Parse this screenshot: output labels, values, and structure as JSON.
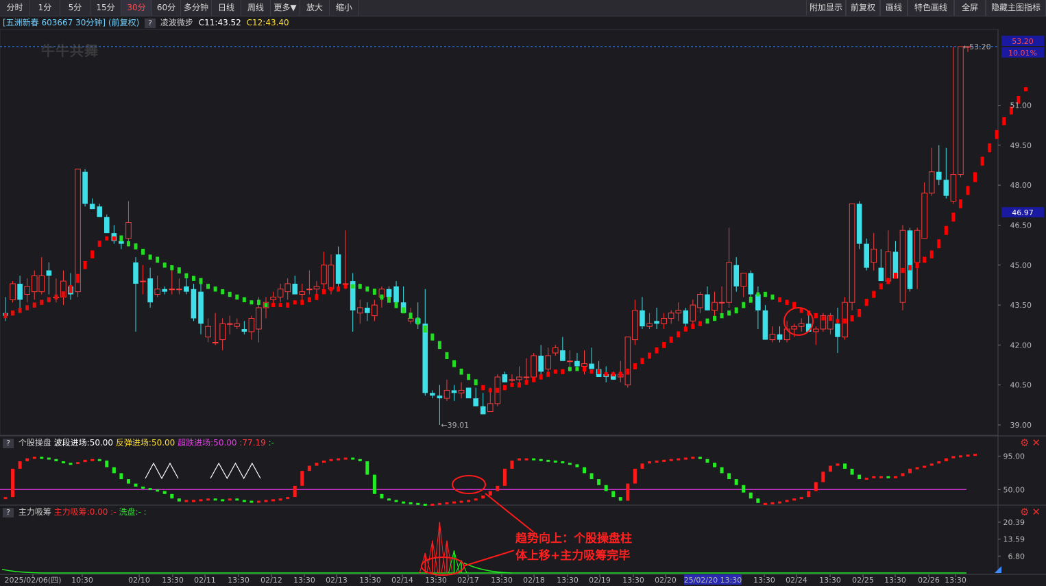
{
  "toolbar": {
    "left": [
      "分时",
      "1分",
      "5分",
      "15分",
      "30分",
      "60分",
      "多分钟",
      "日线",
      "周线",
      "更多▼",
      "放大",
      "缩小"
    ],
    "active_index": 4,
    "right": [
      "附加显示",
      "前复权",
      "画线",
      "特色画线",
      "全屏",
      "隐藏主图指标"
    ]
  },
  "info": {
    "stock": "[五洲新春 603667 30分钟] (前复权)",
    "indicator": "凌波微步",
    "c1": "C11:43.52",
    "c2": "C12:43.40"
  },
  "watermark": "牛牛共舞",
  "colors": {
    "up": "#ff3b3b",
    "down": "#3de0e8",
    "ma_up": "#ff0000",
    "ma_down": "#22dd22",
    "purple": "#cc33cc",
    "axis_text": "#b8b8b8",
    "grid": "#2e2e36",
    "price_box": "#1a1aa0"
  },
  "chart_data": [
    {
      "name": "main",
      "type": "candlestick",
      "y_ticks": [
        39.0,
        40.5,
        42.0,
        43.5,
        45.0,
        46.5,
        48.0,
        49.5,
        51.0
      ],
      "ylim": [
        39.0,
        53.2
      ],
      "tags": {
        "high_price": "53.20",
        "high_pct": "10.01%",
        "current": "46.97"
      },
      "labels": {
        "max": "53.20",
        "min": "39.01"
      },
      "x_labels": [
        "2025/02/06(四)",
        "10:30",
        "02/10",
        "13:30",
        "02/11",
        "13:30",
        "02/12",
        "13:30",
        "02/13",
        "13:30",
        "02/14",
        "13:30",
        "02/17",
        "13:30",
        "02/18",
        "13:30",
        "02/19",
        "13:30",
        "02/20",
        "25/02/20 13:30",
        "13:30",
        "02/24",
        "13:30",
        "02/25",
        "13:30",
        "02/26",
        "13:30"
      ],
      "candles": [
        [
          43.2,
          43.8,
          42.9,
          43.1
        ],
        [
          43.7,
          44.4,
          43.6,
          44.3
        ],
        [
          44.3,
          44.6,
          43.4,
          43.7
        ],
        [
          43.9,
          44.5,
          43.6,
          44.2
        ],
        [
          44.0,
          44.8,
          43.7,
          44.6
        ],
        [
          44.0,
          45.3,
          43.9,
          44.6
        ],
        [
          44.8,
          45.1,
          43.9,
          44.6
        ],
        [
          43.8,
          44.5,
          43.6,
          43.8
        ],
        [
          43.8,
          44.8,
          43.5,
          44.4
        ],
        [
          44.2,
          44.7,
          43.7,
          43.9
        ],
        [
          44.0,
          48.6,
          43.8,
          48.6
        ],
        [
          48.5,
          48.6,
          47.2,
          47.3
        ],
        [
          47.3,
          47.5,
          47.1,
          47.1
        ],
        [
          47.2,
          47.3,
          46.8,
          46.8
        ],
        [
          46.8,
          46.9,
          46.2,
          46.2
        ],
        [
          46.2,
          46.5,
          45.8,
          45.9
        ],
        [
          45.9,
          46.1,
          45.6,
          45.8
        ],
        [
          46.0,
          47.4,
          45.7,
          46.6
        ],
        [
          45.1,
          45.3,
          42.5,
          44.3
        ],
        [
          44.4,
          45.0,
          43.9,
          44.4
        ],
        [
          44.5,
          44.9,
          43.4,
          43.6
        ],
        [
          43.9,
          44.6,
          43.8,
          44.1
        ],
        [
          44.1,
          44.2,
          43.9,
          44.0
        ],
        [
          44.1,
          44.8,
          43.9,
          44.1
        ],
        [
          44.1,
          44.5,
          43.9,
          44.1
        ],
        [
          44.2,
          44.6,
          43.9,
          44.0
        ],
        [
          44.1,
          44.3,
          42.9,
          43.0
        ],
        [
          44.0,
          44.3,
          42.4,
          42.8
        ],
        [
          42.3,
          43.0,
          42.1,
          42.7
        ],
        [
          42.1,
          43.2,
          42.0,
          42.1
        ],
        [
          42.2,
          43.0,
          41.8,
          42.8
        ],
        [
          42.8,
          43.1,
          42.4,
          42.8
        ],
        [
          42.7,
          43.0,
          42.6,
          42.8
        ],
        [
          42.6,
          42.9,
          42.4,
          42.5
        ],
        [
          42.5,
          43.1,
          42.2,
          43.0
        ],
        [
          42.6,
          43.8,
          42.1,
          43.4
        ],
        [
          43.4,
          43.8,
          43.0,
          43.6
        ],
        [
          43.7,
          44.0,
          43.5,
          43.8
        ],
        [
          43.8,
          44.3,
          43.6,
          44.1
        ],
        [
          44.0,
          44.5,
          43.7,
          44.3
        ],
        [
          44.3,
          44.6,
          43.9,
          43.9
        ],
        [
          43.9,
          44.3,
          43.6,
          44.0
        ],
        [
          44.1,
          44.8,
          43.9,
          44.1
        ],
        [
          44.1,
          44.4,
          43.7,
          44.2
        ],
        [
          44.3,
          45.5,
          44.1,
          45.0
        ],
        [
          44.1,
          45.4,
          43.9,
          45.0
        ],
        [
          45.4,
          45.7,
          44.0,
          44.3
        ],
        [
          44.3,
          46.3,
          44.1,
          44.3
        ],
        [
          44.4,
          44.7,
          42.5,
          43.3
        ],
        [
          43.2,
          43.7,
          42.8,
          43.4
        ],
        [
          43.4,
          43.6,
          42.9,
          43.2
        ],
        [
          43.1,
          43.7,
          42.9,
          43.5
        ],
        [
          43.8,
          44.2,
          43.4,
          44.1
        ],
        [
          44.1,
          44.2,
          43.6,
          43.8
        ],
        [
          44.2,
          44.4,
          43.5,
          43.6
        ],
        [
          43.6,
          44.2,
          43.2,
          43.2
        ],
        [
          42.9,
          43.4,
          42.8,
          43.0
        ],
        [
          43.0,
          43.6,
          42.6,
          42.8
        ],
        [
          42.8,
          44.1,
          40.1,
          40.2
        ],
        [
          40.2,
          40.3,
          40.0,
          40.1
        ],
        [
          40.1,
          40.5,
          39.0,
          40.0
        ],
        [
          40.0,
          40.7,
          39.9,
          40.3
        ],
        [
          40.3,
          40.5,
          39.9,
          40.2
        ],
        [
          40.2,
          40.6,
          40.0,
          40.3
        ],
        [
          40.4,
          40.4,
          40.0,
          40.0
        ],
        [
          40.0,
          40.4,
          39.7,
          39.7
        ],
        [
          39.7,
          40.2,
          39.5,
          39.4
        ],
        [
          39.5,
          40.4,
          39.5,
          39.8
        ],
        [
          39.8,
          40.9,
          39.7,
          40.8
        ],
        [
          40.9,
          41.0,
          40.6,
          40.6
        ],
        [
          40.7,
          40.9,
          40.6,
          40.7
        ],
        [
          40.7,
          41.2,
          40.6,
          40.8
        ],
        [
          40.8,
          41.5,
          40.7,
          40.8
        ],
        [
          40.8,
          41.7,
          40.7,
          41.6
        ],
        [
          41.6,
          42.0,
          40.8,
          41.0
        ],
        [
          41.1,
          41.9,
          41.0,
          41.6
        ],
        [
          41.7,
          42.0,
          41.6,
          41.9
        ],
        [
          41.8,
          42.3,
          41.4,
          41.4
        ],
        [
          41.4,
          41.8,
          41.0,
          41.4
        ],
        [
          41.4,
          41.7,
          41.1,
          41.2
        ],
        [
          41.2,
          41.8,
          40.9,
          41.3
        ],
        [
          41.3,
          41.9,
          41.2,
          41.1
        ],
        [
          41.1,
          41.4,
          40.9,
          40.8
        ],
        [
          40.9,
          41.2,
          40.6,
          40.8
        ],
        [
          40.9,
          41.0,
          40.7,
          40.7
        ],
        [
          40.8,
          41.4,
          40.6,
          40.9
        ],
        [
          40.5,
          41.6,
          40.4,
          42.3
        ],
        [
          42.2,
          43.7,
          42.0,
          43.3
        ],
        [
          43.3,
          43.8,
          42.6,
          42.7
        ],
        [
          42.7,
          43.2,
          42.6,
          42.8
        ],
        [
          42.9,
          43.4,
          42.6,
          42.8
        ],
        [
          42.8,
          43.2,
          42.6,
          43.0
        ],
        [
          43.0,
          43.3,
          42.8,
          43.2
        ],
        [
          43.2,
          43.6,
          42.9,
          43.3
        ],
        [
          43.3,
          43.4,
          42.6,
          42.8
        ],
        [
          42.9,
          43.7,
          42.6,
          43.5
        ],
        [
          43.4,
          44.0,
          43.2,
          43.9
        ],
        [
          43.9,
          44.2,
          43.3,
          43.3
        ],
        [
          43.3,
          44.0,
          43.1,
          43.6
        ],
        [
          43.6,
          44.2,
          43.2,
          43.6
        ],
        [
          43.6,
          46.4,
          43.4,
          45.1
        ],
        [
          45.0,
          45.3,
          44.0,
          44.2
        ],
        [
          44.2,
          44.6,
          43.8,
          44.7
        ],
        [
          44.7,
          44.8,
          43.7,
          43.9
        ],
        [
          43.9,
          44.2,
          42.6,
          43.3
        ],
        [
          43.3,
          43.5,
          42.2,
          42.2
        ],
        [
          42.2,
          42.7,
          42.1,
          42.4
        ],
        [
          42.4,
          42.7,
          42.1,
          42.2
        ],
        [
          42.2,
          42.9,
          42.1,
          42.6
        ],
        [
          42.6,
          42.8,
          42.3,
          42.7
        ],
        [
          42.7,
          43.0,
          42.5,
          42.8
        ],
        [
          42.8,
          43.2,
          42.6,
          42.5
        ],
        [
          42.5,
          42.7,
          42.0,
          42.6
        ],
        [
          42.6,
          43.2,
          42.5,
          43.1
        ],
        [
          42.6,
          43.2,
          42.4,
          43.1
        ],
        [
          42.8,
          43.4,
          41.7,
          42.3
        ],
        [
          42.3,
          43.8,
          42.2,
          43.6
        ],
        [
          43.6,
          47.3,
          43.3,
          47.3
        ],
        [
          47.3,
          47.4,
          45.6,
          45.8
        ],
        [
          45.8,
          46.0,
          44.8,
          44.9
        ],
        [
          45.1,
          46.2,
          44.8,
          45.6
        ],
        [
          44.9,
          45.6,
          44.5,
          44.4
        ],
        [
          44.4,
          46.3,
          44.3,
          45.5
        ],
        [
          45.5,
          45.9,
          44.9,
          44.5
        ],
        [
          43.6,
          46.5,
          43.3,
          46.3
        ],
        [
          46.3,
          46.4,
          44.0,
          44.1
        ],
        [
          45.1,
          46.4,
          44.1,
          46.3
        ],
        [
          46.0,
          48.1,
          46.1,
          47.7
        ],
        [
          47.7,
          49.4,
          47.6,
          48.5
        ],
        [
          48.5,
          49.5,
          48.0,
          48.2
        ],
        [
          48.2,
          49.4,
          47.5,
          47.6
        ],
        [
          47.4,
          53.2,
          47.3,
          48.4
        ],
        [
          48.4,
          53.2,
          48.3,
          53.2
        ],
        [
          53.2,
          53.2,
          53.0,
          53.2
        ]
      ],
      "ma": [
        43.1,
        43.2,
        43.3,
        43.4,
        43.5,
        43.6,
        43.7,
        43.8,
        43.9,
        44.1,
        44.5,
        45.0,
        45.4,
        45.8,
        46.0,
        46.0,
        46.0,
        45.8,
        45.7,
        45.5,
        45.3,
        45.2,
        45.0,
        44.9,
        44.8,
        44.6,
        44.5,
        44.4,
        44.2,
        44.1,
        44.0,
        43.9,
        43.8,
        43.7,
        43.6,
        43.6,
        43.5,
        43.5,
        43.5,
        43.5,
        43.6,
        43.6,
        43.7,
        43.8,
        44.0,
        44.1,
        44.1,
        44.2,
        44.2,
        44.2,
        44.1,
        44.0,
        43.8,
        43.7,
        43.5,
        43.3,
        43.1,
        42.9,
        42.6,
        42.3,
        42.0,
        41.6,
        41.3,
        41.0,
        40.8,
        40.6,
        40.4,
        40.3,
        40.3,
        40.4,
        40.5,
        40.5,
        40.6,
        40.7,
        40.8,
        40.9,
        41.0,
        41.0,
        41.1,
        41.1,
        41.1,
        41.0,
        41.0,
        40.9,
        40.9,
        40.9,
        41.0,
        41.2,
        41.4,
        41.6,
        41.8,
        42.0,
        42.2,
        42.4,
        42.6,
        42.7,
        42.8,
        42.9,
        43.0,
        43.1,
        43.2,
        43.3,
        43.5,
        43.7,
        43.9,
        43.9,
        43.8,
        43.7,
        43.6,
        43.5,
        43.3,
        43.2,
        43.1,
        43.0,
        43.0,
        42.9,
        42.9,
        43.0,
        43.2,
        43.6,
        43.9,
        44.2,
        44.4,
        44.6,
        44.8,
        44.9,
        45.0,
        45.2,
        45.4,
        45.8,
        46.3,
        46.8,
        47.3,
        47.8,
        48.3,
        48.9,
        49.4,
        49.9,
        50.4,
        50.8,
        51.2,
        51.6
      ],
      "ma_colors": "ddddddddddrrrrrrgggggggggggggggggggggrrrrrrrrrrrggggggggggggggggggrrrrrrrrrrrrggrrrrrrrrrrrrrrrrrggggggggggrrrrrrrrrrrrrrrrrrrrrrrrrrrr"
    },
    {
      "name": "个股操盘",
      "type": "bar",
      "header": {
        "title": "个股操盘",
        "f1": "波段进场:50.00",
        "f2": "反弹进场:50.00",
        "f3": "超跌进场:50.00",
        "f4": ":77.19",
        "f5": ":-"
      },
      "y_ticks": [
        95.0,
        50.0
      ],
      "ylim": [
        30,
        100
      ],
      "values": [
        40,
        78,
        88,
        92,
        94,
        93,
        91,
        88,
        86,
        85,
        87,
        90,
        91,
        89,
        80,
        72,
        64,
        58,
        54,
        52,
        50,
        48,
        44,
        38,
        34,
        36,
        36,
        37,
        38,
        37,
        36,
        38,
        36,
        35,
        34,
        35,
        36,
        37,
        38,
        40,
        55,
        75,
        82,
        86,
        89,
        91,
        92,
        93,
        91,
        88,
        70,
        44,
        38,
        36,
        34,
        33,
        32,
        31,
        30,
        31,
        32,
        33,
        34,
        35,
        36,
        38,
        42,
        48,
        55,
        78,
        89,
        92,
        92,
        91,
        90,
        89,
        88,
        86,
        84,
        80,
        72,
        64,
        56,
        48,
        40,
        35,
        58,
        78,
        85,
        88,
        89,
        90,
        91,
        92,
        93,
        94,
        91,
        86,
        80,
        72,
        64,
        56,
        46,
        38,
        32,
        32,
        33,
        34,
        36,
        38,
        40,
        48,
        60,
        74,
        82,
        85,
        78,
        70,
        64,
        66,
        68,
        68,
        66,
        68,
        72,
        78,
        80,
        82,
        85,
        88,
        92,
        95,
        96,
        97,
        98
      ]
    },
    {
      "name": "主力吸筹",
      "type": "area",
      "header": {
        "title": "主力吸筹",
        "f1": "主力吸筹:0.00",
        "f2": ":-",
        "f3": "洗盘:-",
        "f4": ":"
      },
      "y_ticks": [
        20.39,
        13.59,
        6.8
      ],
      "ylim": [
        0,
        22
      ],
      "peaks": [
        [
          58,
          8.0
        ],
        [
          59,
          13.0
        ],
        [
          60,
          20.39
        ],
        [
          61,
          13.0
        ],
        [
          62,
          9.0
        ],
        [
          63,
          5.0
        ]
      ]
    }
  ],
  "annotation": [
    "趋势向上：个股操盘柱",
    "体上移+主力吸筹完毕"
  ]
}
